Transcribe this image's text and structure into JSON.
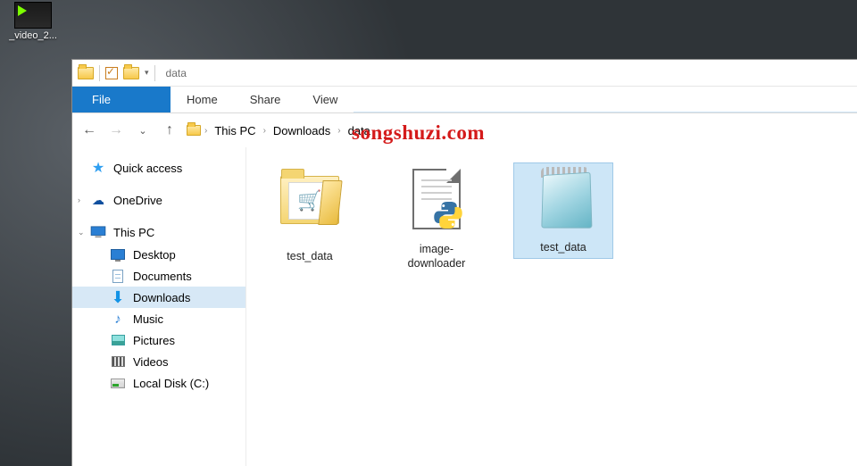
{
  "desktop": {
    "icon_label": "_video_2..."
  },
  "titlebar": {
    "title": "data"
  },
  "ribbon": {
    "file": "File",
    "home": "Home",
    "share": "Share",
    "view": "View"
  },
  "breadcrumb": {
    "root": "This PC",
    "p1": "Downloads",
    "p2": "data"
  },
  "sidebar": {
    "quick_access": "Quick access",
    "onedrive": "OneDrive",
    "this_pc": "This PC",
    "desktop": "Desktop",
    "documents": "Documents",
    "downloads": "Downloads",
    "music": "Music",
    "pictures": "Pictures",
    "videos": "Videos",
    "local_disk": "Local Disk (C:)"
  },
  "files": {
    "f0": "test_data",
    "f1": "image-downloader",
    "f2": "test_data"
  },
  "watermark": "songshuzi.com"
}
